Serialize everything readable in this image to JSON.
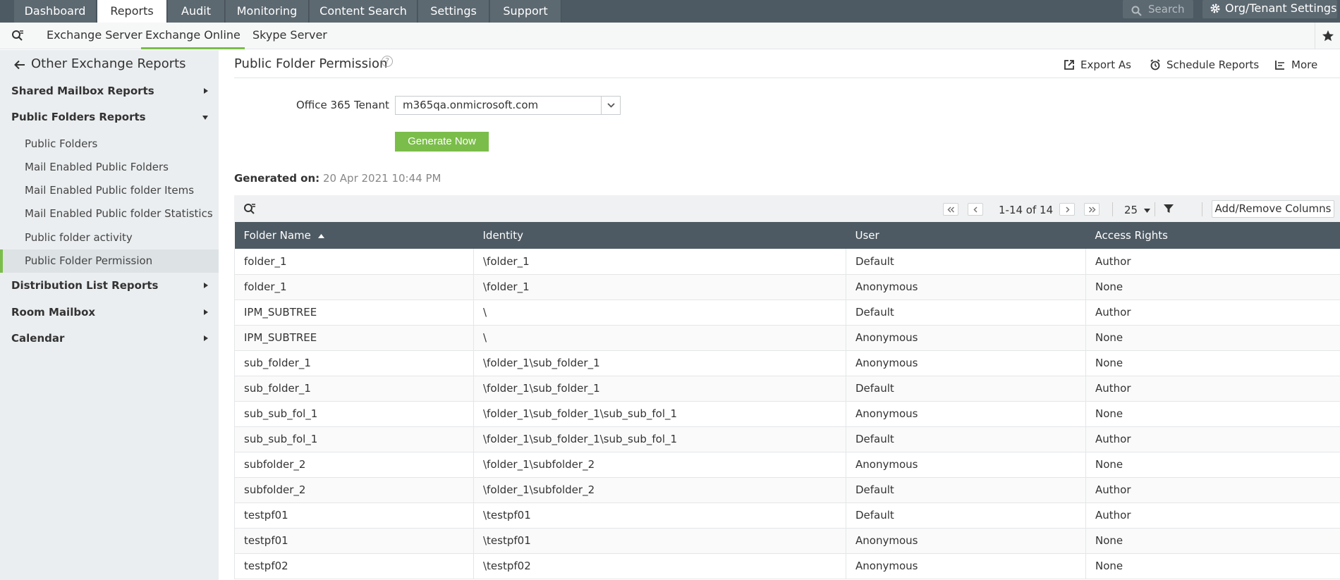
{
  "topnav": {
    "tabs": [
      "Dashboard",
      "Reports",
      "Audit",
      "Monitoring",
      "Content Search",
      "Settings",
      "Support"
    ],
    "active_tab": "Reports",
    "search_placeholder": "Search",
    "org_settings": "Org/Tenant Settings"
  },
  "subnav": {
    "tabs": [
      "Exchange Server",
      "Exchange Online",
      "Skype Server"
    ],
    "active_tab": "Exchange Online"
  },
  "sidebar": {
    "back_label": "Other Exchange Reports",
    "groups": [
      {
        "label": "Shared Mailbox Reports",
        "expanded": false
      },
      {
        "label": "Public Folders Reports",
        "expanded": true,
        "items": [
          "Public Folders",
          "Mail Enabled Public Folders",
          "Mail Enabled Public folder Items",
          "Mail Enabled Public folder Statistics",
          "Public folder activity",
          "Public Folder Permission"
        ]
      },
      {
        "label": "Distribution List Reports",
        "expanded": false
      },
      {
        "label": "Room Mailbox",
        "expanded": false
      },
      {
        "label": "Calendar",
        "expanded": false
      }
    ],
    "active_item": "Public Folder Permission"
  },
  "page": {
    "title": "Public Folder Permission",
    "help": "?",
    "actions": [
      "Export As",
      "Schedule Reports",
      "More"
    ],
    "tenant_label": "Office 365 Tenant",
    "tenant_value": "m365qa.onmicrosoft.com",
    "generate_label": "Generate Now",
    "generated_on_label": "Generated on:",
    "generated_on_value": "20 Apr 2021 10:44 PM"
  },
  "pagination": {
    "info": "1-14 of 14",
    "page_size": "25",
    "add_remove_columns": "Add/Remove Columns"
  },
  "table": {
    "columns": [
      "Folder Name",
      "Identity",
      "User",
      "Access Rights"
    ],
    "sort_column": "Folder Name",
    "rows": [
      [
        "folder_1",
        "\\folder_1",
        "Default",
        "Author"
      ],
      [
        "folder_1",
        "\\folder_1",
        "Anonymous",
        "None"
      ],
      [
        "IPM_SUBTREE",
        "\\",
        "Default",
        "Author"
      ],
      [
        "IPM_SUBTREE",
        "\\",
        "Anonymous",
        "None"
      ],
      [
        "sub_folder_1",
        "\\folder_1\\sub_folder_1",
        "Anonymous",
        "None"
      ],
      [
        "sub_folder_1",
        "\\folder_1\\sub_folder_1",
        "Default",
        "Author"
      ],
      [
        "sub_sub_fol_1",
        "\\folder_1\\sub_folder_1\\sub_sub_fol_1",
        "Anonymous",
        "None"
      ],
      [
        "sub_sub_fol_1",
        "\\folder_1\\sub_folder_1\\sub_sub_fol_1",
        "Default",
        "Author"
      ],
      [
        "subfolder_2",
        "\\folder_1\\subfolder_2",
        "Anonymous",
        "None"
      ],
      [
        "subfolder_2",
        "\\folder_1\\subfolder_2",
        "Default",
        "Author"
      ],
      [
        "testpf01",
        "\\testpf01",
        "Default",
        "Author"
      ],
      [
        "testpf01",
        "\\testpf01",
        "Anonymous",
        "None"
      ],
      [
        "testpf02",
        "\\testpf02",
        "Anonymous",
        "None"
      ]
    ]
  },
  "colors": {
    "nav_bg": "#4e5a63",
    "accent_green": "#7bbd4a",
    "sidebar_bg": "#ebeef0"
  }
}
